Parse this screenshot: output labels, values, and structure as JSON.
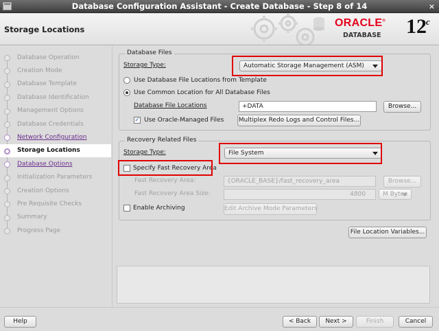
{
  "window": {
    "title": "Database Configuration Assistant - Create Database - Step 8 of 14",
    "close_glyph": "×"
  },
  "header": {
    "page_title": "Storage Locations",
    "logo": {
      "brand": "ORACLE",
      "registered": "®",
      "product": "DATABASE",
      "version": "12",
      "version_suffix": "c"
    }
  },
  "sidebar": {
    "steps": [
      {
        "label": "Database Operation",
        "state": "inactive"
      },
      {
        "label": "Creation Mode",
        "state": "inactive"
      },
      {
        "label": "Database Template",
        "state": "inactive"
      },
      {
        "label": "Database Identification",
        "state": "inactive"
      },
      {
        "label": "Management Options",
        "state": "inactive"
      },
      {
        "label": "Database Credentials",
        "state": "inactive"
      },
      {
        "label": "Network Configuration",
        "state": "done"
      },
      {
        "label": "Storage Locations",
        "state": "current"
      },
      {
        "label": "Database Options",
        "state": "done"
      },
      {
        "label": "Initialization Parameters",
        "state": "inactive"
      },
      {
        "label": "Creation Options",
        "state": "inactive"
      },
      {
        "label": "Pre Requisite Checks",
        "state": "inactive"
      },
      {
        "label": "Summary",
        "state": "inactive"
      },
      {
        "label": "Progress Page",
        "state": "inactive"
      }
    ]
  },
  "database_files": {
    "group_title": "Database Files",
    "storage_type_label": "Storage Type:",
    "storage_type_value": "Automatic Storage Management (ASM)",
    "radio_template_label": "Use Database File Locations from Template",
    "radio_common_label": "Use Common Location for All Database Files",
    "selected_option": "common",
    "file_locations_label": "Database File Locations",
    "file_locations_value": "+DATA",
    "browse_label": "Browse...",
    "omf_label": "Use Oracle-Managed Files",
    "omf_checked": true,
    "multiplex_label": "Multiplex Redo Logs and Control Files..."
  },
  "recovery_files": {
    "group_title": "Recovery Related Files",
    "storage_type_label": "Storage Type:",
    "storage_type_value": "File System",
    "specify_fra_label": "Specify Fast Recovery Area",
    "specify_fra_checked": false,
    "fra_label": "Fast Recovery Area:",
    "fra_value": "{ORACLE_BASE}/fast_recovery_area",
    "fra_browse_label": "Browse...",
    "fra_size_label": "Fast Recovery Area Size:",
    "fra_size_value": "4800",
    "fra_size_unit": "M Bytes",
    "enable_archiving_label": "Enable Archiving",
    "enable_archiving_checked": false,
    "edit_archive_label": "Edit Archive Mode Parameters"
  },
  "file_location_variables_label": "File Location Variables...",
  "footer": {
    "help": "Help",
    "back": "< Back",
    "next": "Next >",
    "finish": "Finish",
    "cancel": "Cancel"
  },
  "colors": {
    "highlight_box": "#e00000",
    "done_step": "#6a2c8c",
    "oracle_red": "#e3001b"
  }
}
